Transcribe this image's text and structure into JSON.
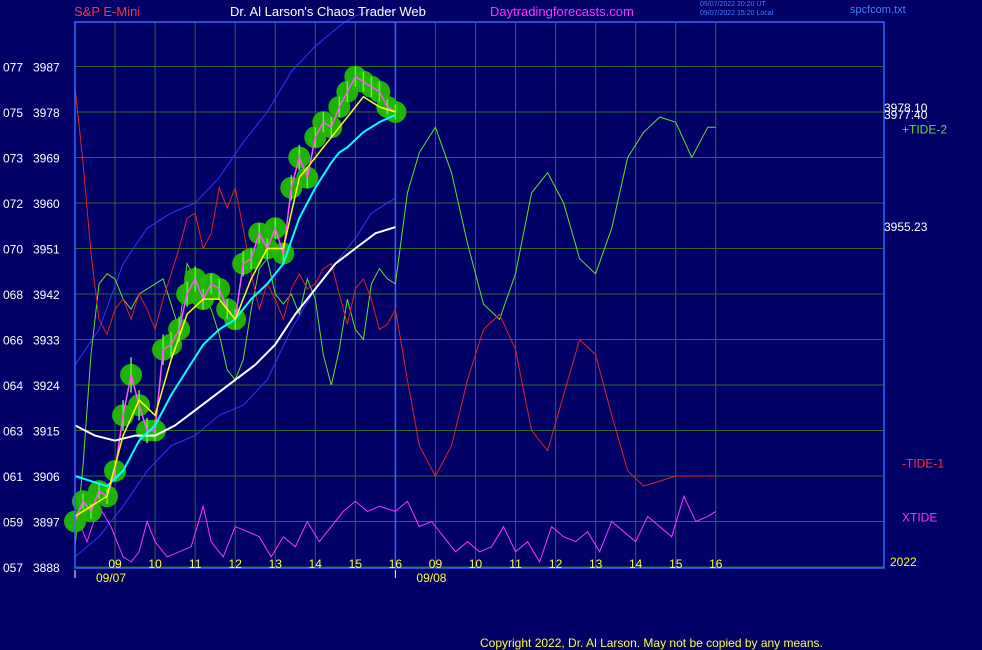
{
  "header": {
    "symbol": "S&P E-Mini",
    "author": "Dr. Al Larson's Chaos Trader Web",
    "site": "Daytradingforecasts.com",
    "time_utc": "09/07/2022 20:20 UT",
    "time_local": "09/07/2022 15:20 Local",
    "file": "spcfcom.txt"
  },
  "footer": {
    "copyright": "Copyright 2022, Dr. Al Larson. May not be copied by any means."
  },
  "colors": {
    "background": "#000066",
    "frame": "#3366ff",
    "grid": "#336633",
    "price_bar": "#ff55ff",
    "fast_avg": "#ffff00",
    "slow_avg": "#00ffff",
    "long_avg": "#ffffff",
    "band": "#3333ff",
    "tide_plus": "#66dd33",
    "tide_minus": "#dd2222",
    "xtide": "#ff33ff",
    "glow": "#22bb00",
    "label_red": "#ff3333",
    "label_white": "#ffffff",
    "label_magenta": "#ff33ff",
    "label_yellow": "#ffff33"
  },
  "chart_data": {
    "type": "line",
    "y_ticks": [
      {
        "code": "077",
        "price": "3987",
        "value": 3987
      },
      {
        "code": "075",
        "price": "3978",
        "value": 3978
      },
      {
        "code": "073",
        "price": "3969",
        "value": 3969
      },
      {
        "code": "072",
        "price": "3960",
        "value": 3960
      },
      {
        "code": "070",
        "price": "3951",
        "value": 3951
      },
      {
        "code": "068",
        "price": "3942",
        "value": 3942
      },
      {
        "code": "066",
        "price": "3933",
        "value": 3933
      },
      {
        "code": "064",
        "price": "3924",
        "value": 3924
      },
      {
        "code": "063",
        "price": "3915",
        "value": 3915
      },
      {
        "code": "061",
        "price": "3906",
        "value": 3906
      },
      {
        "code": "059",
        "price": "3897",
        "value": 3897
      },
      {
        "code": "057",
        "price": "3888",
        "value": 3888
      }
    ],
    "ylim": [
      3888,
      3998
    ],
    "xlim": [
      8.0,
      28.2
    ],
    "x_ticks": [
      {
        "label": "09",
        "x": 9
      },
      {
        "label": "10",
        "x": 10
      },
      {
        "label": "11",
        "x": 11
      },
      {
        "label": "12",
        "x": 12
      },
      {
        "label": "13",
        "x": 13
      },
      {
        "label": "14",
        "x": 14
      },
      {
        "label": "15",
        "x": 15
      },
      {
        "label": "16",
        "x": 16
      },
      {
        "label": "09",
        "x": 17
      },
      {
        "label": "10",
        "x": 18
      },
      {
        "label": "11",
        "x": 19
      },
      {
        "label": "12",
        "x": 20
      },
      {
        "label": "13",
        "x": 21
      },
      {
        "label": "14",
        "x": 22
      },
      {
        "label": "15",
        "x": 23
      },
      {
        "label": "16",
        "x": 24
      }
    ],
    "dates": [
      {
        "label": "09/07",
        "x": 8.0
      },
      {
        "label": "09/08",
        "x": 16.0
      }
    ],
    "year": "2022",
    "day_divider_x": 16.0,
    "right_labels": [
      {
        "text": "3978.10",
        "value": 3978.8
      },
      {
        "text": "3977.40",
        "value": 3977.4
      },
      {
        "text": "3955.23",
        "value": 3955.23
      }
    ],
    "series_labels": [
      {
        "text": "+TIDE-2",
        "value": 3974.5
      },
      {
        "text": "-TIDE-1",
        "value": 3908.5
      },
      {
        "text": "XTIDE",
        "value": 3897.8
      }
    ],
    "price": {
      "x": [
        8.0,
        8.2,
        8.4,
        8.6,
        8.8,
        9.0,
        9.2,
        9.4,
        9.6,
        9.8,
        10.0,
        10.2,
        10.4,
        10.6,
        10.8,
        11.0,
        11.2,
        11.4,
        11.6,
        11.8,
        12.0,
        12.2,
        12.4,
        12.6,
        12.8,
        13.0,
        13.2,
        13.4,
        13.6,
        13.8,
        14.0,
        14.2,
        14.4,
        14.6,
        14.8,
        15.0,
        15.2,
        15.4,
        15.6,
        15.8,
        16.0
      ],
      "close": [
        3897,
        3901,
        3899,
        3903,
        3902,
        3907,
        3918,
        3926,
        3920,
        3915,
        3915,
        3931,
        3932,
        3935,
        3942,
        3945,
        3941,
        3944,
        3943,
        3939,
        3937,
        3948,
        3949,
        3954,
        3951,
        3955,
        3950,
        3963,
        3969,
        3965,
        3973,
        3976,
        3975,
        3979,
        3982,
        3985,
        3984,
        3983,
        3982,
        3979,
        3978
      ],
      "spread": [
        3,
        3,
        3,
        3,
        3,
        4,
        6,
        7,
        6,
        5,
        4,
        6,
        5,
        5,
        5,
        5,
        4,
        4,
        4,
        4,
        4,
        5,
        4,
        4,
        4,
        4,
        4,
        5,
        5,
        4,
        4,
        4,
        4,
        4,
        4,
        4,
        4,
        4,
        4,
        3,
        3
      ]
    },
    "fast_avg": {
      "x": [
        8.0,
        8.4,
        8.8,
        9.2,
        9.6,
        10.0,
        10.4,
        10.8,
        11.2,
        11.6,
        12.0,
        12.4,
        12.8,
        13.2,
        13.6,
        14.0,
        14.4,
        14.8,
        15.2,
        15.6,
        16.0
      ],
      "values": [
        3898,
        3900,
        3902,
        3914,
        3921,
        3918,
        3929,
        3938,
        3941,
        3941,
        3937,
        3945,
        3951,
        3951,
        3965,
        3969,
        3973,
        3977,
        3981,
        3979,
        3978
      ]
    },
    "slow_avg": {
      "x": [
        8.0,
        8.4,
        8.8,
        9.2,
        9.6,
        10.0,
        10.4,
        10.8,
        11.2,
        11.6,
        12.0,
        12.4,
        12.8,
        13.2,
        13.6,
        14.0,
        14.4,
        14.6,
        14.8,
        15.2,
        15.6,
        16.0
      ],
      "values": [
        3906,
        3905,
        3904,
        3907,
        3913,
        3916,
        3922,
        3927,
        3932,
        3935,
        3937,
        3941,
        3944,
        3948,
        3957,
        3963,
        3968,
        3970,
        3971,
        3974,
        3976,
        3977.4
      ]
    },
    "long_avg": {
      "x": [
        8.0,
        8.5,
        9.0,
        9.5,
        10.0,
        10.5,
        11.0,
        11.5,
        12.0,
        12.5,
        13.0,
        13.5,
        14.0,
        14.5,
        15.0,
        15.5,
        16.0
      ],
      "values": [
        3916,
        3914,
        3913,
        3914,
        3914,
        3916,
        3919,
        3922,
        3925,
        3928,
        3932,
        3938,
        3943,
        3948,
        3951,
        3954,
        3955.23
      ]
    },
    "upper_band": {
      "x": [
        8.0,
        8.6,
        9.2,
        9.8,
        10.4,
        11.0,
        11.6,
        12.2,
        12.8,
        13.4,
        14.0,
        14.6,
        15.0,
        15.4,
        16.0
      ],
      "values": [
        3928,
        3935,
        3948,
        3955,
        3958,
        3960,
        3965,
        3972,
        3978,
        3986,
        3991,
        3995,
        3997,
        3998,
        3998
      ]
    },
    "lower_band": {
      "x": [
        8.0,
        8.6,
        9.2,
        9.8,
        10.4,
        11.0,
        11.6,
        12.2,
        12.8,
        13.4,
        14.0,
        14.6,
        15.0,
        15.4,
        16.0
      ],
      "values": [
        3890,
        3894,
        3900,
        3907,
        3912,
        3914,
        3918,
        3920,
        3925,
        3935,
        3943,
        3949,
        3953,
        3958,
        3961
      ]
    },
    "tide_plus": {
      "x": [
        8.0,
        8.2,
        8.4,
        8.6,
        8.8,
        9.0,
        9.2,
        9.4,
        9.6,
        9.8,
        10.0,
        10.2,
        10.4,
        10.6,
        10.8,
        11.0,
        11.2,
        11.4,
        11.6,
        11.8,
        12.0,
        12.2,
        12.4,
        12.6,
        12.8,
        13.0,
        13.2,
        13.4,
        13.6,
        13.8,
        14.0,
        14.2,
        14.4,
        14.6,
        14.8,
        15.0,
        15.2,
        15.4,
        15.6,
        15.8,
        16.0,
        16.3,
        16.6,
        17.0,
        17.4,
        17.8,
        18.2,
        18.6,
        19.0,
        19.4,
        19.8,
        20.2,
        20.6,
        21.0,
        21.4,
        21.8,
        22.2,
        22.6,
        23.0,
        23.4,
        23.8,
        24.0
      ],
      "values": [
        3892,
        3908,
        3930,
        3944,
        3946,
        3945,
        3941,
        3939,
        3942,
        3943,
        3944,
        3945,
        3940,
        3935,
        3948,
        3945,
        3941,
        3939,
        3934,
        3927,
        3925,
        3929,
        3939,
        3947,
        3949,
        3942,
        3940,
        3942,
        3938,
        3945,
        3941,
        3930,
        3924,
        3931,
        3941,
        3935,
        3933,
        3944,
        3947,
        3945,
        3944,
        3962,
        3970,
        3975,
        3966,
        3952,
        3940,
        3937,
        3946,
        3962,
        3966,
        3960,
        3949,
        3946,
        3955,
        3969,
        3974,
        3977,
        3976,
        3969,
        3975,
        3975
      ]
    },
    "tide_minus": {
      "x": [
        8.0,
        8.2,
        8.4,
        8.6,
        8.8,
        9.0,
        9.2,
        9.4,
        9.6,
        9.8,
        10.0,
        10.2,
        10.4,
        10.6,
        10.8,
        11.0,
        11.2,
        11.4,
        11.6,
        11.8,
        12.0,
        12.2,
        12.4,
        12.6,
        12.8,
        13.0,
        13.2,
        13.4,
        13.6,
        13.8,
        14.0,
        14.2,
        14.4,
        14.6,
        14.8,
        15.0,
        15.2,
        15.4,
        15.6,
        15.8,
        16.0,
        16.3,
        16.6,
        17.0,
        17.4,
        17.8,
        18.2,
        18.6,
        19.0,
        19.4,
        19.8,
        20.2,
        20.6,
        21.0,
        21.4,
        21.8,
        22.2,
        22.6,
        23.0,
        23.4,
        23.8,
        24.0
      ],
      "values": [
        3983,
        3968,
        3950,
        3937,
        3934,
        3939,
        3941,
        3937,
        3942,
        3939,
        3935,
        3941,
        3946,
        3951,
        3957,
        3958,
        3951,
        3954,
        3963,
        3959,
        3963,
        3955,
        3946,
        3939,
        3944,
        3941,
        3937,
        3943,
        3946,
        3943,
        3944,
        3947,
        3948,
        3942,
        3936,
        3943,
        3945,
        3941,
        3935,
        3936,
        3939,
        3925,
        3912,
        3906,
        3912,
        3925,
        3935,
        3938,
        3931,
        3915,
        3911,
        3922,
        3933,
        3930,
        3918,
        3907,
        3904,
        3905,
        3906,
        3906,
        3906,
        3906
      ]
    },
    "xtide": {
      "x": [
        8.0,
        8.3,
        8.6,
        8.9,
        9.2,
        9.4,
        9.6,
        9.8,
        10.0,
        10.3,
        10.6,
        10.9,
        11.2,
        11.4,
        11.7,
        12.0,
        12.3,
        12.6,
        12.9,
        13.2,
        13.5,
        13.8,
        14.1,
        14.4,
        14.7,
        15.0,
        15.3,
        15.6,
        16.0,
        16.3,
        16.6,
        16.9,
        17.2,
        17.5,
        17.8,
        18.1,
        18.4,
        18.7,
        19.0,
        19.3,
        19.6,
        19.9,
        20.2,
        20.5,
        20.8,
        21.1,
        21.4,
        21.7,
        22.0,
        22.3,
        22.6,
        22.9,
        23.2,
        23.5,
        23.8,
        24.0
      ],
      "values": [
        3899,
        3893,
        3900,
        3896,
        3890,
        3889,
        3891,
        3897,
        3893,
        3890,
        3891,
        3892,
        3900,
        3893,
        3890,
        3896,
        3895,
        3894,
        3890,
        3894,
        3892,
        3897,
        3893,
        3896,
        3899,
        3901,
        3899,
        3900,
        3899,
        3901,
        3896,
        3897,
        3894,
        3891,
        3893,
        3891,
        3892,
        3896,
        3891,
        3893,
        3889,
        3896,
        3894,
        3893,
        3895,
        3891,
        3897,
        3895,
        3893,
        3898,
        3896,
        3894,
        3902,
        3897,
        3898,
        3899
      ]
    }
  }
}
